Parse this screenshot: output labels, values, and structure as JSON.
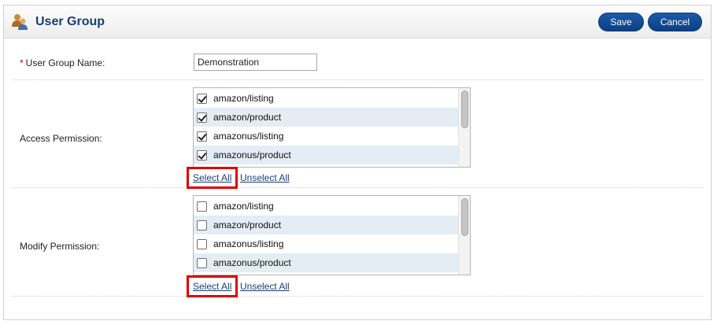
{
  "header": {
    "icon": "user-group-icon",
    "title": "User Group",
    "save_label": "Save",
    "cancel_label": "Cancel"
  },
  "form": {
    "name": {
      "required_mark": "*",
      "label": "User Group Name:",
      "value": "Demonstration"
    },
    "access": {
      "label": "Access Permission:",
      "items": [
        {
          "label": "amazon/listing",
          "checked": true
        },
        {
          "label": "amazon/product",
          "checked": true
        },
        {
          "label": "amazonus/listing",
          "checked": true
        },
        {
          "label": "amazonus/product",
          "checked": true
        }
      ],
      "select_all": "Select All",
      "unselect_all": "Unselect All"
    },
    "modify": {
      "label": "Modify Permission:",
      "items": [
        {
          "label": "amazon/listing",
          "checked": false
        },
        {
          "label": "amazon/product",
          "checked": false
        },
        {
          "label": "amazonus/listing",
          "checked": false
        },
        {
          "label": "amazonus/product",
          "checked": false
        }
      ],
      "select_all": "Select All",
      "unselect_all": "Unselect All"
    }
  },
  "colors": {
    "accent": "#1a3f74",
    "button": "#0d3f82",
    "highlight": "#e00000",
    "row_alt": "#e4ecf4"
  }
}
